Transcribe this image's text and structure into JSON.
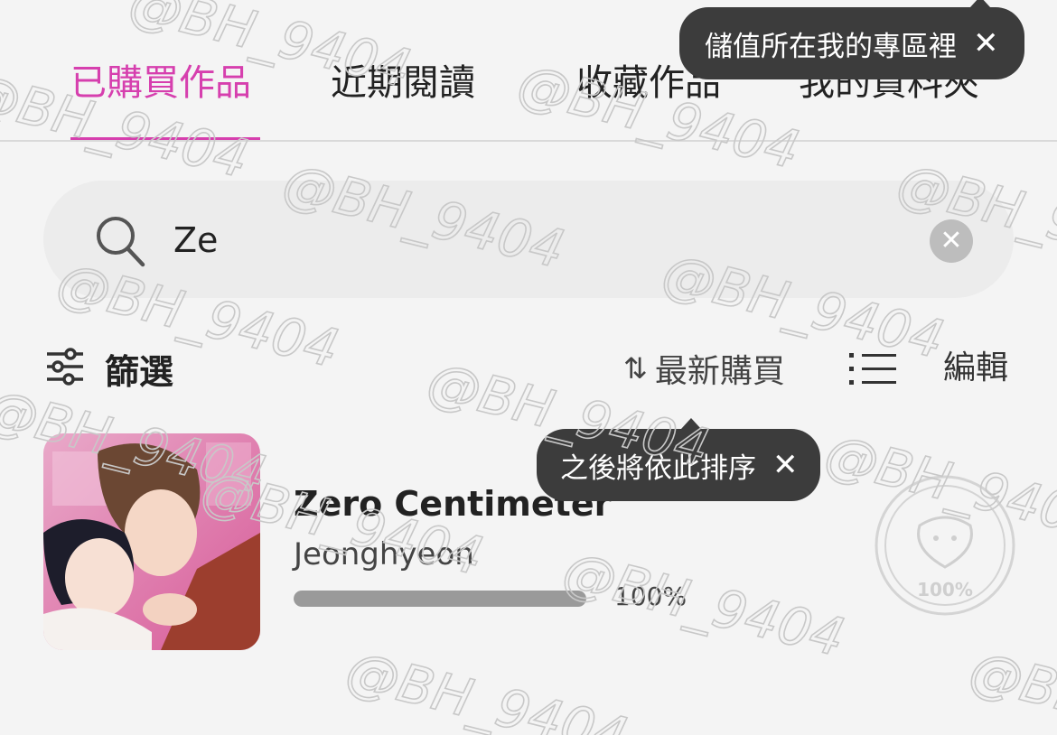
{
  "tabs": [
    {
      "label": "已購買作品",
      "active": true
    },
    {
      "label": "近期閱讀",
      "active": false
    },
    {
      "label": "收藏作品",
      "active": false
    },
    {
      "label": "我的資料夾",
      "active": false
    }
  ],
  "tooltips": {
    "top": {
      "text": "儲值所在我的專區裡",
      "close": "✕"
    },
    "sort": {
      "text": "之後將依此排序",
      "close": "✕"
    }
  },
  "search": {
    "value": "Ze",
    "placeholder": "",
    "clear": "✕"
  },
  "toolbar": {
    "filter_label": "篩選",
    "sort_arrow": "⇅",
    "sort_label": "最新購買",
    "edit_label": "編輯"
  },
  "items": [
    {
      "title": "Zero Centimeter",
      "author": "Jeonghyeon",
      "progress": 1.0,
      "progress_label": "100%",
      "badge_label": "100%"
    }
  ],
  "watermark": "@BH_9404",
  "colors": {
    "accent": "#d63fae",
    "background": "#f4f4f4",
    "tooltip": "#3c3c3c",
    "progress": "#9a9a9a"
  },
  "icons": [
    "search-icon",
    "filter-icon",
    "sort-icon",
    "list-view-icon",
    "close-icon",
    "completed-badge-icon"
  ]
}
